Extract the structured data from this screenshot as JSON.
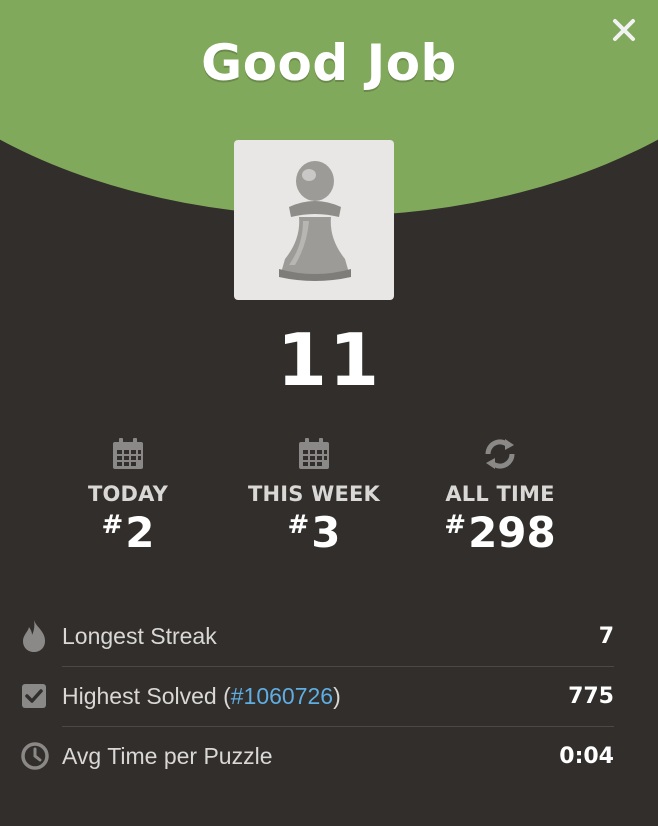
{
  "header": {
    "title": "Good Job"
  },
  "score": "11",
  "ranks": [
    {
      "label": "TODAY",
      "hash": "#",
      "value": "2",
      "icon": "calendar-icon"
    },
    {
      "label": "THIS WEEK",
      "hash": "#",
      "value": "3",
      "icon": "calendar-icon"
    },
    {
      "label": "ALL TIME",
      "hash": "#",
      "value": "298",
      "icon": "refresh-icon"
    }
  ],
  "stats": {
    "longest_streak": {
      "label": "Longest Streak",
      "value": "7",
      "icon": "flame-icon"
    },
    "highest_solved": {
      "label_prefix": "Highest Solved (",
      "link": "#1060726",
      "label_suffix": ")",
      "value": "775",
      "icon": "checkbox-icon"
    },
    "avg_time": {
      "label": "Avg Time per Puzzle",
      "value": "0:04",
      "icon": "clock-icon"
    }
  },
  "colors": {
    "header_green": "#81a95b",
    "background": "#312e2b",
    "link_blue": "#5eaee3"
  }
}
